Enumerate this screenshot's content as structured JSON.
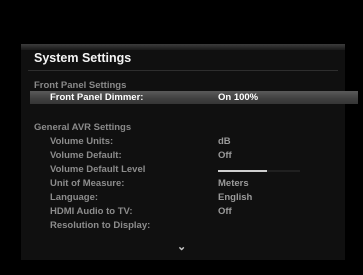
{
  "title": "System Settings",
  "sections": {
    "front_panel": "Front Panel Settings",
    "general_avr": "General AVR Settings"
  },
  "front_panel_dimmer": {
    "label": "Front Panel Dimmer:",
    "value": "On 100%"
  },
  "volume_units": {
    "label": "Volume Units:",
    "value": "dB"
  },
  "volume_default": {
    "label": "Volume Default:",
    "value": "Off"
  },
  "volume_default_level": {
    "label": "Volume Default Level",
    "level": 0.6
  },
  "unit_of_measure": {
    "label": "Unit of Measure:",
    "value": "Meters"
  },
  "language": {
    "label": "Language:",
    "value": "English"
  },
  "hdmi_audio_to_tv": {
    "label": "HDMI Audio to TV:",
    "value": "Off"
  },
  "resolution_to_display": {
    "label": "Resolution to Display:",
    "value": ""
  },
  "scroll_indicator": "⌄",
  "colors": {
    "selected_bar": "#4a4a4a",
    "background": "#000000",
    "panel": "#101010"
  }
}
